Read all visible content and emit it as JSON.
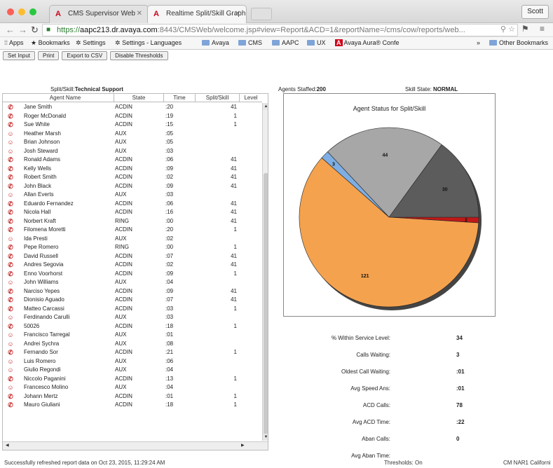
{
  "browser": {
    "tabs": [
      {
        "label": "CMS Supervisor Web",
        "active": false
      },
      {
        "label": "Realtime Split/Skill Graphic",
        "active": true
      }
    ],
    "user_button": "Scott",
    "url": {
      "scheme": "https://",
      "host": "aapc213.dr.avaya.com",
      "path": ":8443/CMSWeb/welcome.jsp#view=Report&ACD=1&reportName=/cms/cow/reports/web..."
    },
    "bookmarks": [
      {
        "label": "Apps",
        "icon": "apps-icon"
      },
      {
        "label": "Bookmarks",
        "icon": "star-icon"
      },
      {
        "label": "Settings",
        "icon": "gear-icon"
      },
      {
        "label": "Settings - Languages",
        "icon": "gear-icon"
      },
      {
        "label": "Avaya",
        "icon": "folder-icon"
      },
      {
        "label": "CMS",
        "icon": "folder-icon"
      },
      {
        "label": "AAPC",
        "icon": "folder-icon"
      },
      {
        "label": "UX",
        "icon": "folder-icon"
      },
      {
        "label": "Avaya Aura® Confe",
        "icon": "avaya-icon"
      }
    ],
    "other_bookmarks": "Other Bookmarks"
  },
  "actions": {
    "set_input": "Set Input",
    "print": "Print",
    "export_csv": "Export to CSV",
    "disable_thresholds": "Disable Thresholds"
  },
  "split": {
    "label": "Split/Skill:",
    "name": "Technical Support"
  },
  "table": {
    "headers": [
      "Agent Name",
      "State",
      "Time",
      "Split/Skill",
      "Level"
    ],
    "rows": [
      {
        "name": "Jane Smith",
        "state": "ACDIN",
        "time": ":20",
        "skill": "41"
      },
      {
        "name": "Roger McDonald",
        "state": "ACDIN",
        "time": ":19",
        "skill": "1"
      },
      {
        "name": "Sue White",
        "state": "ACDIN",
        "time": ":15",
        "skill": "1"
      },
      {
        "name": "Heather Marsh",
        "state": "AUX",
        "time": ":05",
        "skill": ""
      },
      {
        "name": "Brian Johnson",
        "state": "AUX",
        "time": ":05",
        "skill": ""
      },
      {
        "name": "Josh Steward",
        "state": "AUX",
        "time": ":03",
        "skill": ""
      },
      {
        "name": "Ronald Adams",
        "state": "ACDIN",
        "time": ":06",
        "skill": "41"
      },
      {
        "name": "Kelly Wells",
        "state": "ACDIN",
        "time": ":09",
        "skill": "41"
      },
      {
        "name": "Robert Smith",
        "state": "ACDIN",
        "time": ":02",
        "skill": "41"
      },
      {
        "name": "John Black",
        "state": "ACDIN",
        "time": ":09",
        "skill": "41"
      },
      {
        "name": "Allan Everts",
        "state": "AUX",
        "time": ":03",
        "skill": ""
      },
      {
        "name": "Eduardo Fernandez",
        "state": "ACDIN",
        "time": ":06",
        "skill": "41"
      },
      {
        "name": "Nicola Hall",
        "state": "ACDIN",
        "time": ":16",
        "skill": "41"
      },
      {
        "name": "Norbert Kraft",
        "state": "RING",
        "time": ":00",
        "skill": "41"
      },
      {
        "name": "Filomena Moretti",
        "state": "ACDIN",
        "time": ":20",
        "skill": "1"
      },
      {
        "name": "Ida Presti",
        "state": "AUX",
        "time": ":02",
        "skill": ""
      },
      {
        "name": "Pepe Romero",
        "state": "RING",
        "time": ":00",
        "skill": "1"
      },
      {
        "name": "David Russell",
        "state": "ACDIN",
        "time": ":07",
        "skill": "41"
      },
      {
        "name": "Andres Segovia",
        "state": "ACDIN",
        "time": ":02",
        "skill": "41"
      },
      {
        "name": "Enno Voorhorst",
        "state": "ACDIN",
        "time": ":09",
        "skill": "1"
      },
      {
        "name": "John Williams",
        "state": "AUX",
        "time": ":04",
        "skill": ""
      },
      {
        "name": "Narciso Yepes",
        "state": "ACDIN",
        "time": ":09",
        "skill": "41"
      },
      {
        "name": "Dionisio Aguado",
        "state": "ACDIN",
        "time": ":07",
        "skill": "41"
      },
      {
        "name": "Matteo Carcassi",
        "state": "ACDIN",
        "time": ":03",
        "skill": "1"
      },
      {
        "name": "Ferdinando Carulli",
        "state": "AUX",
        "time": ":03",
        "skill": ""
      },
      {
        "name": "50026",
        "state": "ACDIN",
        "time": ":18",
        "skill": "1"
      },
      {
        "name": "Francisco Tarregal",
        "state": "AUX",
        "time": ":01",
        "skill": ""
      },
      {
        "name": "Andrei Sychra",
        "state": "AUX",
        "time": ":08",
        "skill": ""
      },
      {
        "name": "Fernando Sor",
        "state": "ACDIN",
        "time": ":21",
        "skill": "1"
      },
      {
        "name": "Luis Romero",
        "state": "AUX",
        "time": ":06",
        "skill": ""
      },
      {
        "name": "Giulio Regondi",
        "state": "AUX",
        "time": ":04",
        "skill": ""
      },
      {
        "name": "Niccolo Paganini",
        "state": "ACDIN",
        "time": ":13",
        "skill": "1"
      },
      {
        "name": "Francesco Molino",
        "state": "AUX",
        "time": ":04",
        "skill": ""
      },
      {
        "name": "Johann Mertz",
        "state": "ACDIN",
        "time": ":01",
        "skill": "1"
      },
      {
        "name": "Mauro Giuliani",
        "state": "ACDIN",
        "time": ":18",
        "skill": "1"
      }
    ]
  },
  "staffed": {
    "label": "Agents Staffed:",
    "value": "200"
  },
  "skill_state": {
    "label": "Skill State:",
    "value": "NORMAL"
  },
  "chart_data": {
    "type": "pie",
    "title": "Agent Status for Split/Skill",
    "slices": [
      {
        "label": "2",
        "value": 2,
        "color": "#c01818"
      },
      {
        "label": "30",
        "value": 30,
        "color": "#5c5c5c"
      },
      {
        "label": "44",
        "value": 44,
        "color": "#a7a7a7"
      },
      {
        "label": "3",
        "value": 3,
        "color": "#7eaee3"
      },
      {
        "label": "121",
        "value": 121,
        "color": "#f5a24e"
      }
    ]
  },
  "metrics": [
    {
      "label": "% Within Service Level:",
      "value": "34"
    },
    {
      "label": "Calls Waiting:",
      "value": "3"
    },
    {
      "label": "Oldest Call Waiting:",
      "value": ":01"
    },
    {
      "label": "Avg Speed Ans:",
      "value": ":01"
    },
    {
      "label": "ACD Calls:",
      "value": "78"
    },
    {
      "label": "Avg ACD Time:",
      "value": ":22"
    },
    {
      "label": "Aban Calls:",
      "value": "0"
    },
    {
      "label": "Avg Aban Time:",
      "value": ""
    }
  ],
  "status": {
    "refresh": "Successfully refreshed report data on Oct 23, 2015, 11:29:24 AM",
    "thresholds": "Thresholds: On",
    "location": "CM NAR1 Californi"
  }
}
